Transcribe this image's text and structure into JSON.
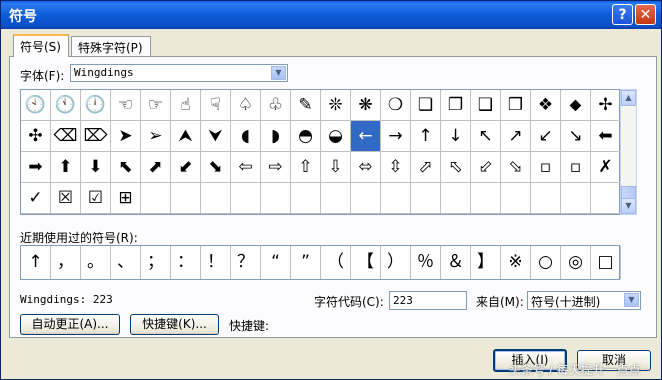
{
  "window": {
    "title": "符号",
    "help_label": "?",
    "close_label": "✕"
  },
  "tabs": [
    {
      "label": "符号(S)"
    },
    {
      "label": "特殊字符(P)"
    }
  ],
  "font": {
    "label": "字体(F):",
    "value": "Wingdings"
  },
  "symbol_grid": [
    [
      "🕙",
      "🕚",
      "🕛",
      "☜",
      "☞",
      "☝",
      "☟",
      "♤",
      "♧",
      "✎",
      "❊",
      "❋",
      "❍",
      "❏",
      "❐",
      "❑",
      "❒",
      "❖",
      "⬥",
      "✢"
    ],
    [
      "✣",
      "⌫",
      "⌦",
      "➤",
      "➢",
      "⮝",
      "⮟",
      "◖",
      "◗",
      "◓",
      "◒",
      "←",
      "→",
      "↑",
      "↓",
      "↖",
      "↗",
      "↙",
      "↘",
      "⬅"
    ],
    [
      "➡",
      "⬆",
      "⬇",
      "⬉",
      "⬈",
      "⬋",
      "⬊",
      "⇦",
      "⇨",
      "⇧",
      "⇩",
      "⬄",
      "⇳",
      "⬀",
      "⬁",
      "⬃",
      "⬂",
      "▫",
      "▫",
      "✗"
    ],
    [
      "✓",
      "☒",
      "☑",
      "⊞",
      "",
      "",
      "",
      "",
      "",
      "",
      "",
      "",
      "",
      "",
      "",
      "",
      "",
      "",
      "",
      ""
    ]
  ],
  "selected_cell": {
    "row": 1,
    "col": 11
  },
  "recent": {
    "label": "近期使用过的符号(R):",
    "symbols": [
      "↑",
      "，",
      "。",
      "、",
      "；",
      "：",
      "！",
      "？",
      "“",
      "”",
      "（",
      "【",
      "）",
      "％",
      "＆",
      "】",
      "※",
      "○",
      "◎",
      "□"
    ]
  },
  "status": {
    "font_code": "Wingdings: 223",
    "char_code_label": "字符代码(C):",
    "char_code_value": "223",
    "from_label": "来自(M):",
    "from_value": "符号(十进制)"
  },
  "buttons": {
    "autocorrect": "自动更正(A)...",
    "shortcut_key": "快捷键(K)...",
    "shortcut_label": "快捷键:",
    "insert": "插入(I)",
    "cancel": "取消"
  },
  "watermark": "头条号 / 每天提升一点点"
}
